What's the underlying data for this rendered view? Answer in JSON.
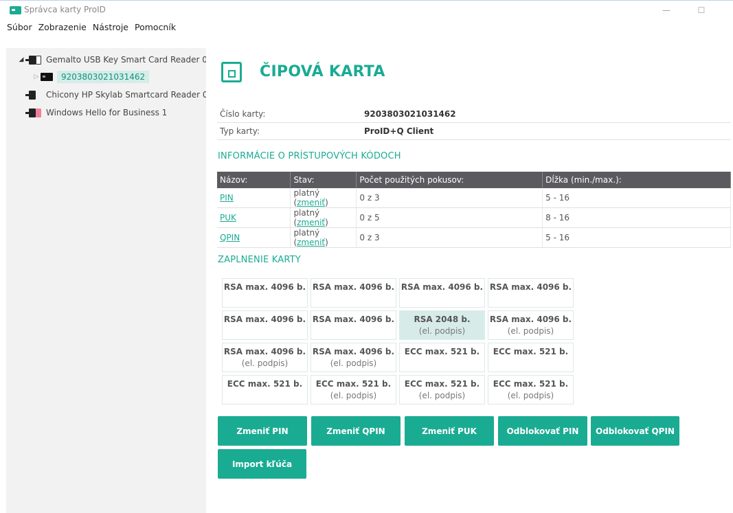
{
  "window": {
    "title": "Správca karty ProID",
    "minimize_glyph": "—",
    "maximize_glyph": "☐"
  },
  "menu": [
    "Súbor",
    "Zobrazenie",
    "Nástroje",
    "Pomocník"
  ],
  "tree": {
    "items": [
      {
        "label": "Gemalto USB Key Smart Card Reader 0",
        "icon": "usb-reader-icon",
        "expanded": true
      },
      {
        "label": "9203803021031462",
        "icon": "smartcard-icon",
        "selected": true
      },
      {
        "label": "Chicony HP Skylab Smartcard Reader 0",
        "icon": "reader-icon"
      },
      {
        "label": "Windows Hello for Business 1",
        "icon": "hello-reader-icon"
      }
    ],
    "expanded_glyph": "◢",
    "collapsed_glyph": "▷"
  },
  "card": {
    "heading": "ČIPOVÁ KARTA",
    "number_label": "Číslo karty:",
    "number_value": "9203803021031462",
    "type_label": "Typ karty:",
    "type_value": "ProID+Q Client"
  },
  "access_codes": {
    "section_title": "INFORMÁCIE O PRÍSTUPOVÝCH KÓDOCH",
    "headers": [
      "Názov:",
      "Stav:",
      "Počet použitých pokusov:",
      "Dĺžka (min./max.):"
    ],
    "rows": [
      {
        "name": "PIN",
        "status": "platný",
        "change": "zmeniť",
        "attempts": "0 z 3",
        "length": "5 - 16"
      },
      {
        "name": "PUK",
        "status": "platný",
        "change": "zmeniť",
        "attempts": "0 z 5",
        "length": "8 - 16"
      },
      {
        "name": "QPIN",
        "status": "platný",
        "change": "zmeniť",
        "attempts": "0 z 3",
        "length": "5 - 16"
      }
    ]
  },
  "capacity": {
    "section_title": "ZAPLNENIE KARTY",
    "slots": [
      {
        "main": "RSA max. 4096 b.",
        "sub": ""
      },
      {
        "main": "RSA max. 4096 b.",
        "sub": ""
      },
      {
        "main": "RSA max. 4096 b.",
        "sub": ""
      },
      {
        "main": "RSA max. 4096 b.",
        "sub": ""
      },
      {
        "main": "RSA max. 4096 b.",
        "sub": ""
      },
      {
        "main": "RSA max. 4096 b.",
        "sub": ""
      },
      {
        "main": "RSA 2048 b.",
        "sub": "(el. podpis)",
        "highlight": true
      },
      {
        "main": "RSA max. 4096 b.",
        "sub": "(el. podpis)"
      },
      {
        "main": "RSA max. 4096 b.",
        "sub": "(el. podpis)"
      },
      {
        "main": "RSA max. 4096 b.",
        "sub": "(el. podpis)"
      },
      {
        "main": "ECC max. 521 b.",
        "sub": ""
      },
      {
        "main": "ECC max. 521 b.",
        "sub": ""
      },
      {
        "main": "ECC max. 521 b.",
        "sub": ""
      },
      {
        "main": "ECC max. 521 b.",
        "sub": "(el. podpis)"
      },
      {
        "main": "ECC max. 521 b.",
        "sub": "(el. podpis)"
      },
      {
        "main": "ECC max. 521 b.",
        "sub": "(el. podpis)"
      }
    ]
  },
  "actions": {
    "change_pin": "Zmeniť PIN",
    "change_qpin": "Zmeniť QPIN",
    "change_puk": "Zmeniť PUK",
    "unblock_pin": "Odblokovať PIN",
    "unblock_qpin": "Odblokovať QPIN",
    "import_key": "Import kľúča"
  },
  "colors": {
    "accent": "#1aab93",
    "table_header": "#5b5b5f",
    "sidebar_bg": "#f2f2f2"
  }
}
